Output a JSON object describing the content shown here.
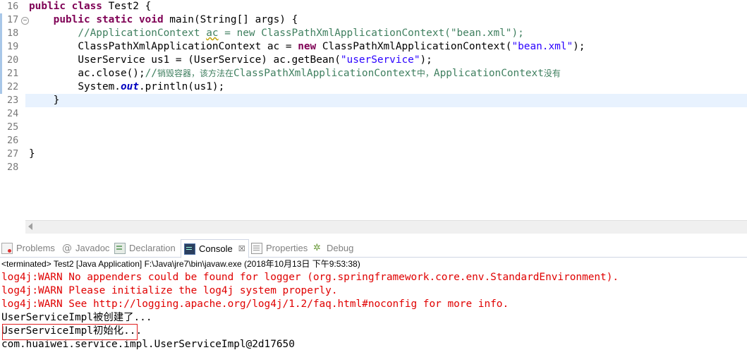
{
  "editor": {
    "line_numbers": [
      "16",
      "17",
      "18",
      "19",
      "20",
      "21",
      "22",
      "23",
      "24",
      "25",
      "26",
      "27",
      "28"
    ],
    "lines": {
      "l16": {
        "kw1": "public",
        "kw2": "class",
        "rest": " Test2 {"
      },
      "l17": {
        "kw1": "public",
        "kw2": "static",
        "kw3": "void",
        "rest": " main(String[] args) {"
      },
      "l18": {
        "comment_a": "//ApplicationContext ",
        "comment_b": "ac",
        "comment_c": " = new ClassPathXmlApplicationContext(\"bean.xml\");"
      },
      "l19": {
        "a": "ClassPathXmlApplicationContext ac = ",
        "kw": "new",
        "b": " ClassPathXmlApplicationContext(",
        "str": "\"bean.xml\"",
        "c": ");"
      },
      "l20": {
        "a": "UserService us1 = (UserService) ac.getBean(",
        "str": "\"userService\"",
        "c": ");"
      },
      "l21": {
        "a": "ac.close();",
        "comment_a": "//",
        "comment_cjk1": "销毁容器，该方法在",
        "comment_b": "ClassPathXmlApplicationContext",
        "comment_cjk2": "中，",
        "comment_c": "ApplicationContext",
        "comment_cjk3": "没有"
      },
      "l22": {
        "a": "System.",
        "field": "out",
        "b": ".println(us1);"
      },
      "l23": {
        "a": "}"
      },
      "l27": {
        "a": "}"
      }
    }
  },
  "views": {
    "tabs": [
      {
        "label": "Problems",
        "icon": "problems-icon"
      },
      {
        "label": "Javadoc",
        "icon": "javadoc-icon"
      },
      {
        "label": "Declaration",
        "icon": "declaration-icon"
      },
      {
        "label": "Console",
        "icon": "console-icon",
        "close": "☒"
      },
      {
        "label": "Properties",
        "icon": "properties-icon"
      },
      {
        "label": "Debug",
        "icon": "debug-icon"
      }
    ],
    "status": "<terminated> Test2 [Java Application] F:\\Java\\jre7\\bin\\javaw.exe (2018年10月13日 下午9:53:38)"
  },
  "console": {
    "lines": [
      "log4j:WARN No appenders could be found for logger (org.springframework.core.env.StandardEnvironment).",
      "log4j:WARN Please initialize the log4j system properly.",
      "log4j:WARN See http://logging.apache.org/log4j/1.2/faq.html#noconfig for more info.",
      "UserServiceImpl被创建了...",
      "UserServiceImpl初始化...",
      "com.huaiwei.service.impl.UserServiceImpl@2d17650"
    ],
    "colors": {
      "error": "#e00000",
      "normal": "#000000",
      "highlight_box": "#e02020"
    }
  }
}
